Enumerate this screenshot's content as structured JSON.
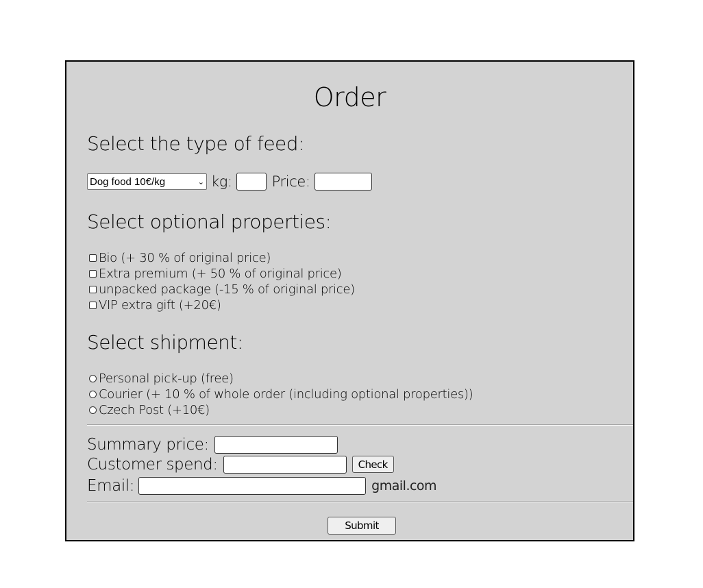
{
  "form": {
    "title": "Order",
    "feed_section": {
      "heading": "Select the type of feed:",
      "feed_select": {
        "selected": "Dog food 10€/kg"
      },
      "kg_label": "kg:",
      "kg_value": "",
      "price_label": "Price:",
      "price_value": ""
    },
    "optional_section": {
      "heading": "Select optional properties:",
      "options": [
        {
          "label": "Bio (+ 30 % of original price)",
          "checked": false
        },
        {
          "label": "Extra premium (+ 50 % of original price)",
          "checked": false
        },
        {
          "label": "unpacked package (-15 % of original price)",
          "checked": false
        },
        {
          "label": "VIP extra gift (+20€)",
          "checked": false
        }
      ]
    },
    "shipment_section": {
      "heading": "Select shipment:",
      "options": [
        {
          "label": "Personal pick-up (free)",
          "selected": false
        },
        {
          "label": "Courier (+ 10 % of whole order (including optional properties))",
          "selected": false
        },
        {
          "label": "Czech Post (+10€)",
          "selected": false
        }
      ]
    },
    "summary": {
      "summary_price_label": "Summary price:",
      "summary_price_value": "",
      "customer_spend_label": "Customer spend:",
      "customer_spend_value": "",
      "check_button": "Check",
      "email_label": "Email:",
      "email_value": "",
      "email_suffix": "gmail.com"
    },
    "submit_button": "Submit"
  }
}
